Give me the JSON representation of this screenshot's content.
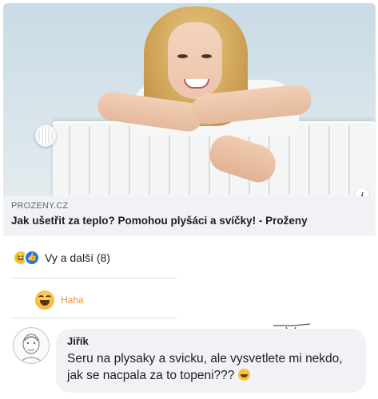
{
  "link_preview": {
    "source": "PROZENY.CZ",
    "title": "Jak ušetřit za teplo? Pomohou plyšáci a svíčky! - Proženy",
    "info_icon": "info-icon"
  },
  "reactions": {
    "summary": "Vy a další (8)",
    "icons": [
      "haha-reaction-icon",
      "like-reaction-icon"
    ]
  },
  "reaction_button": {
    "label": "Haha",
    "color": "#e2953d"
  },
  "comment": {
    "author": "Jiřík",
    "text": "Seru na plysaky a svicku, ale vysvetlete mi nekdo, jak se nacpala za to topeni???"
  },
  "colors": {
    "accent_blue": "#1877f2",
    "haha_orange": "#e2953d",
    "bubble_bg": "#f0f2f5"
  }
}
